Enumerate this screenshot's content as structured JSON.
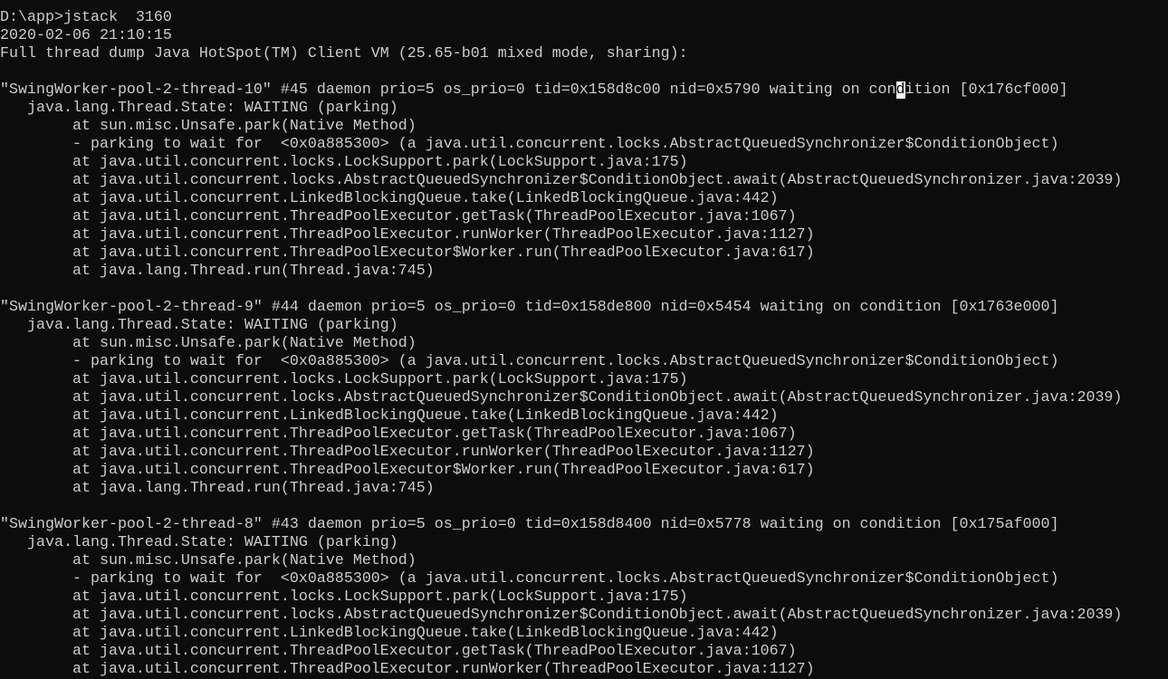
{
  "colors": {
    "background": "#0c0c0c",
    "text": "#cccccc",
    "cursor": "#f2f2f2"
  },
  "console": {
    "lines": [
      "D:\\app>jstack  3160",
      "2020-02-06 21:10:15",
      "Full thread dump Java HotSpot(TM) Client VM (25.65-b01 mixed mode, sharing):",
      "",
      "\"SwingWorker-pool-2-thread-10\" #45 daemon prio=5 os_prio=0 tid=0x158d8c00 nid=0x5790 waiting on condition [0x176cf000]",
      "   java.lang.Thread.State: WAITING (parking)",
      "        at sun.misc.Unsafe.park(Native Method)",
      "        - parking to wait for  <0x0a885300> (a java.util.concurrent.locks.AbstractQueuedSynchronizer$ConditionObject)",
      "        at java.util.concurrent.locks.LockSupport.park(LockSupport.java:175)",
      "        at java.util.concurrent.locks.AbstractQueuedSynchronizer$ConditionObject.await(AbstractQueuedSynchronizer.java:2039)",
      "        at java.util.concurrent.LinkedBlockingQueue.take(LinkedBlockingQueue.java:442)",
      "        at java.util.concurrent.ThreadPoolExecutor.getTask(ThreadPoolExecutor.java:1067)",
      "        at java.util.concurrent.ThreadPoolExecutor.runWorker(ThreadPoolExecutor.java:1127)",
      "        at java.util.concurrent.ThreadPoolExecutor$Worker.run(ThreadPoolExecutor.java:617)",
      "        at java.lang.Thread.run(Thread.java:745)",
      "",
      "\"SwingWorker-pool-2-thread-9\" #44 daemon prio=5 os_prio=0 tid=0x158de800 nid=0x5454 waiting on condition [0x1763e000]",
      "   java.lang.Thread.State: WAITING (parking)",
      "        at sun.misc.Unsafe.park(Native Method)",
      "        - parking to wait for  <0x0a885300> (a java.util.concurrent.locks.AbstractQueuedSynchronizer$ConditionObject)",
      "        at java.util.concurrent.locks.LockSupport.park(LockSupport.java:175)",
      "        at java.util.concurrent.locks.AbstractQueuedSynchronizer$ConditionObject.await(AbstractQueuedSynchronizer.java:2039)",
      "        at java.util.concurrent.LinkedBlockingQueue.take(LinkedBlockingQueue.java:442)",
      "        at java.util.concurrent.ThreadPoolExecutor.getTask(ThreadPoolExecutor.java:1067)",
      "        at java.util.concurrent.ThreadPoolExecutor.runWorker(ThreadPoolExecutor.java:1127)",
      "        at java.util.concurrent.ThreadPoolExecutor$Worker.run(ThreadPoolExecutor.java:617)",
      "        at java.lang.Thread.run(Thread.java:745)",
      "",
      "\"SwingWorker-pool-2-thread-8\" #43 daemon prio=5 os_prio=0 tid=0x158d8400 nid=0x5778 waiting on condition [0x175af000]",
      "   java.lang.Thread.State: WAITING (parking)",
      "        at sun.misc.Unsafe.park(Native Method)",
      "        - parking to wait for  <0x0a885300> (a java.util.concurrent.locks.AbstractQueuedSynchronizer$ConditionObject)",
      "        at java.util.concurrent.locks.LockSupport.park(LockSupport.java:175)",
      "        at java.util.concurrent.locks.AbstractQueuedSynchronizer$ConditionObject.await(AbstractQueuedSynchronizer.java:2039)",
      "        at java.util.concurrent.LinkedBlockingQueue.take(LinkedBlockingQueue.java:442)",
      "        at java.util.concurrent.ThreadPoolExecutor.getTask(ThreadPoolExecutor.java:1067)",
      "        at java.util.concurrent.ThreadPoolExecutor.runWorker(ThreadPoolExecutor.java:1127)"
    ]
  }
}
